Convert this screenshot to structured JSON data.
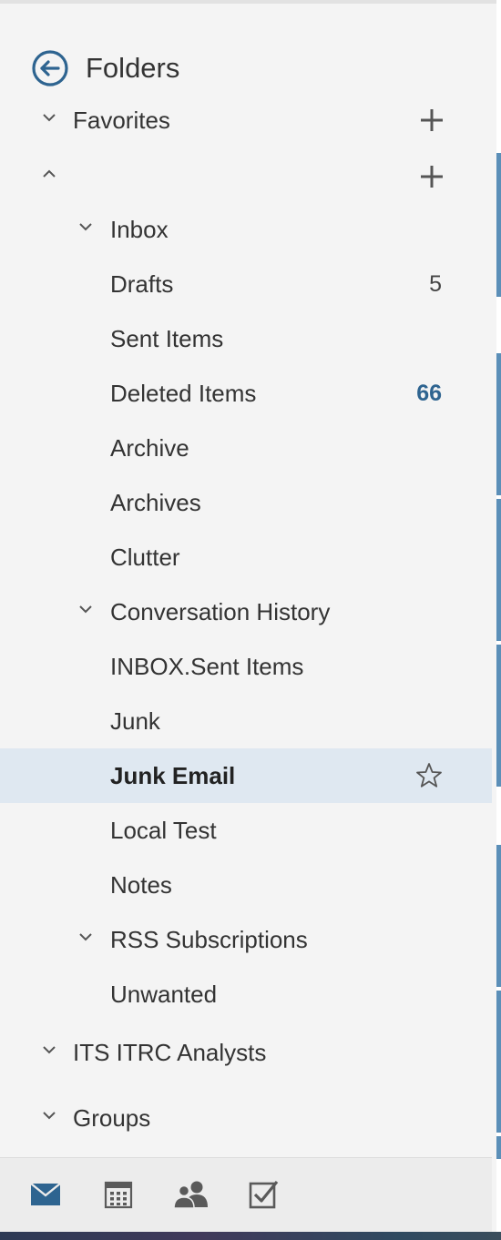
{
  "header": {
    "title": "Folders",
    "back_icon": "back-arrow-icon"
  },
  "sections": {
    "favorites": {
      "label": "Favorites",
      "expanded": false
    },
    "account": {
      "label": "",
      "expanded": true
    },
    "its_itrc_analysts": {
      "label": "ITS ITRC Analysts",
      "expanded": false
    },
    "groups": {
      "label": "Groups",
      "expanded": false
    }
  },
  "folders": [
    {
      "label": "Inbox",
      "level": 1,
      "expandable": true,
      "count": ""
    },
    {
      "label": "Drafts",
      "level": 2,
      "expandable": false,
      "count": "5"
    },
    {
      "label": "Sent Items",
      "level": 2,
      "expandable": false,
      "count": ""
    },
    {
      "label": "Deleted Items",
      "level": 2,
      "expandable": false,
      "count": "66"
    },
    {
      "label": "Archive",
      "level": 2,
      "expandable": false,
      "count": ""
    },
    {
      "label": "Archives",
      "level": 2,
      "expandable": false,
      "count": ""
    },
    {
      "label": "Clutter",
      "level": 2,
      "expandable": false,
      "count": ""
    },
    {
      "label": "Conversation History",
      "level": 1,
      "expandable": true,
      "count": ""
    },
    {
      "label": "INBOX.Sent Items",
      "level": 2,
      "expandable": false,
      "count": ""
    },
    {
      "label": "Junk",
      "level": 2,
      "expandable": false,
      "count": ""
    },
    {
      "label": "Junk Email",
      "level": 2,
      "expandable": false,
      "count": "",
      "selected": true
    },
    {
      "label": "Local Test",
      "level": 2,
      "expandable": false,
      "count": ""
    },
    {
      "label": "Notes",
      "level": 2,
      "expandable": false,
      "count": ""
    },
    {
      "label": "RSS Subscriptions",
      "level": 1,
      "expandable": true,
      "count": ""
    },
    {
      "label": "Unwanted",
      "level": 2,
      "expandable": false,
      "count": ""
    }
  ],
  "bottom_nav": [
    {
      "name": "mail-icon",
      "active": true
    },
    {
      "name": "calendar-icon",
      "active": false
    },
    {
      "name": "people-icon",
      "active": false
    },
    {
      "name": "tasks-icon",
      "active": false
    }
  ],
  "colors": {
    "accent": "#2e6490",
    "selected_row": "#dfe8f1",
    "panel_bg": "#f4f4f4",
    "icon_gray": "#5a5a5a"
  }
}
